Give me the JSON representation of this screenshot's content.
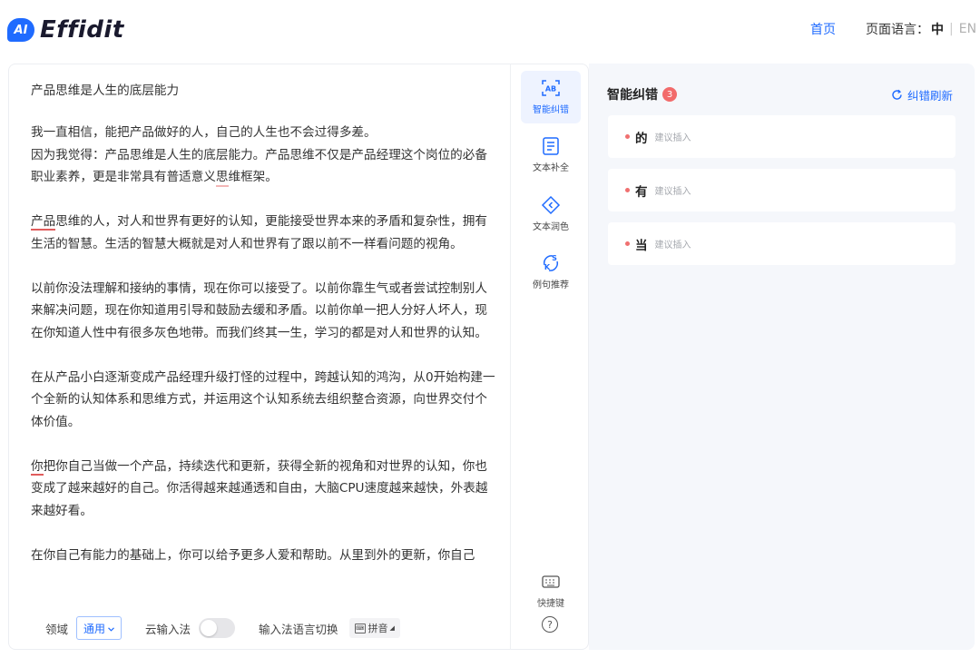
{
  "header": {
    "logo_badge": "AI",
    "logo_text": "Effidit",
    "nav_home": "首页",
    "lang_label": "页面语言：",
    "lang_zh": "中",
    "lang_en": "EN"
  },
  "editor": {
    "title": "产品思维是人生的底层能力",
    "paragraphs": [
      "我一直相信，能把产品做好的人，自己的人生也不会过得多差。因为我觉得：产品思维是人生的底层能力。产品思维不仅是产品经理这个岗位的必备职业素养，更是非常具有普适意义思维框架。",
      "产品思维的人，对人和世界有更好的认知，更能接受世界本来的矛盾和复杂性，拥有生活的智慧。生活的智慧大概就是对人和世界有了跟以前不一样看问题的视角。",
      "以前你没法理解和接纳的事情，现在你可以接受了。以前你靠生气或者尝试控制别人来解决问题，现在你知道用引导和鼓励去缓和矛盾。以前你单一把人分好人坏人，现在你知道人性中有很多灰色地带。而我们终其一生，学习的都是对人和世界的认知。",
      "在从产品小白逐渐变成产品经理升级打怪的过程中，跨越认知的鸿沟，从0开始构建一个全新的认知体系和思维方式，并运用这个认知系统去组织整合资源，向世界交付个体价值。",
      "你把你自己当做一个产品，持续迭代和更新，获得全新的视角和对世界的认知，你也变成了越来越好的自己。你活得越来越通透和自由，大脑CPU速度越来越快，外表越来越好看。",
      "在你自己有能力的基础上，你可以给予更多人爱和帮助。从里到外的更新，你自己"
    ],
    "p1_parts": {
      "line1": "我一直相信，能把产品做好的人，自己的人生也不会过得多差。",
      "line2a": "因为我觉得：产品思维是人生的底层能力。产品思维不仅是产品经理这个岗位的必备职业素养，更是非常具有普适意义",
      "mark": "思",
      "line2b": "维框架。"
    },
    "p2_parts": {
      "mark": "产品",
      "rest": "思维的人，对人和世界有更好的认知，更能接受世界本来的矛盾和复杂性，拥有生活的智慧。生活的智慧大概就是对人和世界有了跟以前不一样看问题的视角。"
    },
    "p5_parts": {
      "mark": "你",
      "rest": "把你自己当做一个产品，持续迭代和更新，获得全新的视角和对世界的认知，你也变成了越来越好的自己。你活得越来越通透和自由，大脑CPU速度越来越快，外表越来越好看。"
    },
    "footer": {
      "domain_label": "领域",
      "domain_value": "通用",
      "cloud_ime_label": "云输入法",
      "cloud_ime_on": false,
      "ime_switch_label": "输入法语言切换",
      "pinyin_label": "拼音"
    }
  },
  "tools": {
    "items": [
      {
        "label": "智能纠错",
        "icon": "error-correction-icon",
        "active": true
      },
      {
        "label": "文本补全",
        "icon": "text-completion-icon",
        "active": false
      },
      {
        "label": "文本润色",
        "icon": "text-polish-icon",
        "active": false
      },
      {
        "label": "例句推荐",
        "icon": "sentence-recommend-icon",
        "active": false
      }
    ],
    "shortcut_label": "快捷键",
    "help_symbol": "?"
  },
  "panel": {
    "title": "智能纠错",
    "count": "3",
    "refresh_label": "纠错刷新",
    "suggestions": [
      {
        "word": "的",
        "hint": "建议插入"
      },
      {
        "word": "有",
        "hint": "建议插入"
      },
      {
        "word": "当",
        "hint": "建议插入"
      }
    ]
  },
  "colors": {
    "accent": "#1f6bff",
    "error": "#f26b6b",
    "panel_bg": "#f5f7fb"
  }
}
